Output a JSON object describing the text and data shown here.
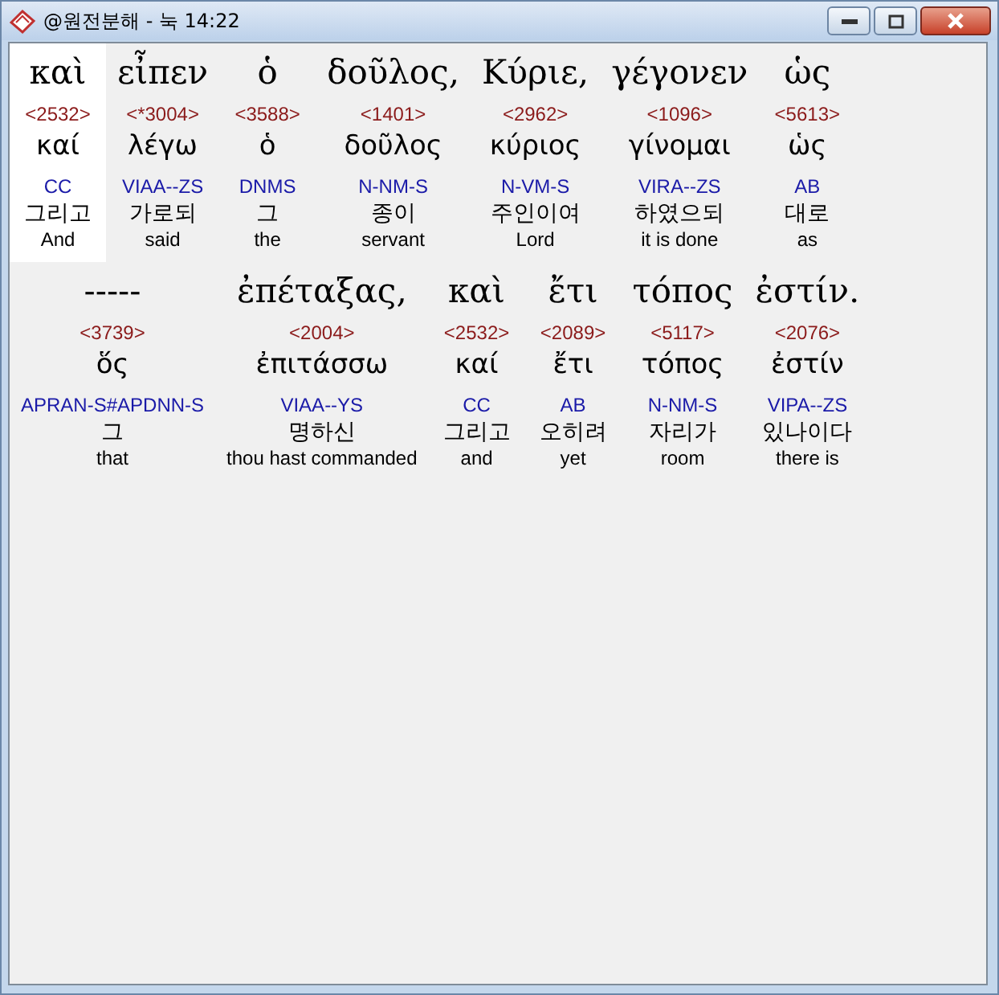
{
  "window": {
    "title": "@원전분해 - 눅 14:22"
  },
  "words": [
    {
      "greek": "καὶ",
      "strong": "<2532>",
      "lemma": "καί",
      "morph": "CC",
      "korean": "그리고",
      "english": "And",
      "selected": true
    },
    {
      "greek": "εἶπεν",
      "strong": "<*3004>",
      "lemma": "λέγω",
      "morph": "VIAA--ZS",
      "korean": "가로되",
      "english": "said",
      "selected": false
    },
    {
      "greek": "ὁ",
      "strong": "<3588>",
      "lemma": "ὁ",
      "morph": "DNMS",
      "korean": "그",
      "english": "the",
      "selected": false
    },
    {
      "greek": "δοῦλος,",
      "strong": "<1401>",
      "lemma": "δοῦλος",
      "morph": "N-NM-S",
      "korean": "종이",
      "english": "servant",
      "selected": false
    },
    {
      "greek": "Κύριε,",
      "strong": "<2962>",
      "lemma": "κύριος",
      "morph": "N-VM-S",
      "korean": "주인이여",
      "english": "Lord",
      "selected": false
    },
    {
      "greek": "γέγονεν",
      "strong": "<1096>",
      "lemma": "γίνομαι",
      "morph": "VIRA--ZS",
      "korean": "하였으되",
      "english": "it is done",
      "selected": false
    },
    {
      "greek": "ὡς",
      "strong": "<5613>",
      "lemma": "ὡς",
      "morph": "AB",
      "korean": "대로",
      "english": "as",
      "selected": false
    },
    {
      "greek": "-----",
      "strong": "<3739>",
      "lemma": "ὅς",
      "morph": "APRAN-S#APDNN-S",
      "korean": "그",
      "english": "that",
      "selected": false
    },
    {
      "greek": "ἐπέταξας,",
      "strong": "<2004>",
      "lemma": "ἐπιτάσσω",
      "morph": "VIAA--YS",
      "korean": "명하신",
      "english": "thou hast commanded",
      "selected": false
    },
    {
      "greek": "καὶ",
      "strong": "<2532>",
      "lemma": "καί",
      "morph": "CC",
      "korean": "그리고",
      "english": "and",
      "selected": false
    },
    {
      "greek": "ἔτι",
      "strong": "<2089>",
      "lemma": "ἔτι",
      "morph": "AB",
      "korean": "오히려",
      "english": "yet",
      "selected": false
    },
    {
      "greek": "τόπος",
      "strong": "<5117>",
      "lemma": "τόπος",
      "morph": "N-NM-S",
      "korean": "자리가",
      "english": "room",
      "selected": false
    },
    {
      "greek": "ἐστίν.",
      "strong": "<2076>",
      "lemma": "ἐστίν",
      "morph": "VIPA--ZS",
      "korean": "있나이다",
      "english": "there is",
      "selected": false
    }
  ]
}
